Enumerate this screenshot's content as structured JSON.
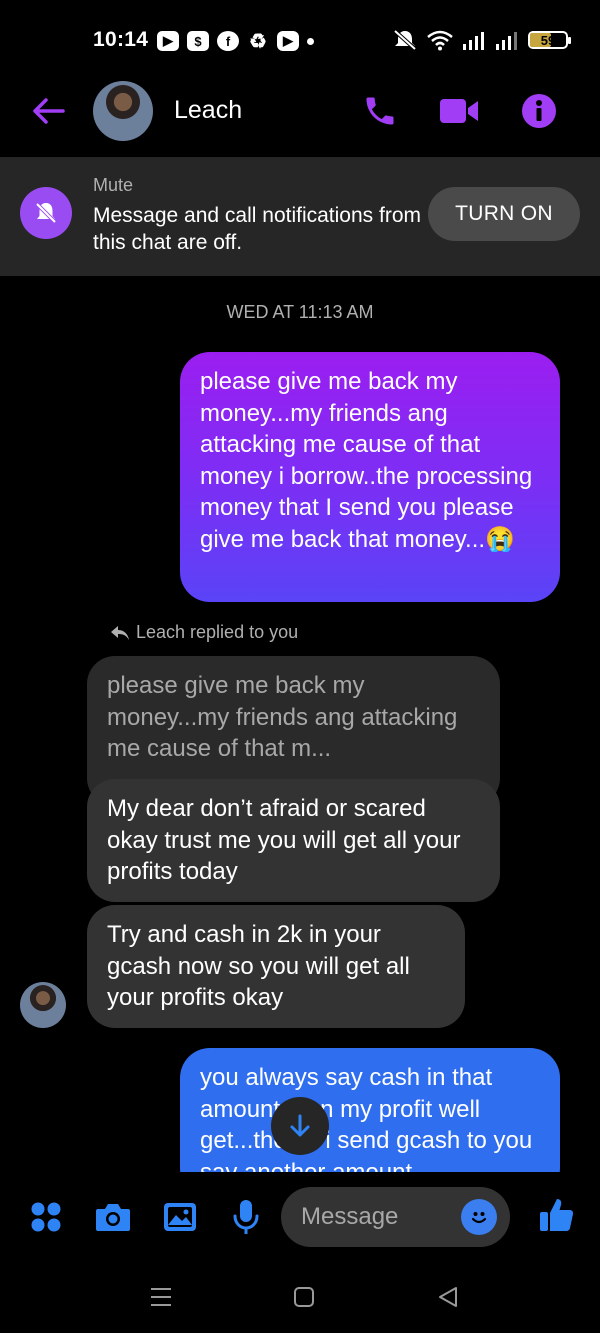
{
  "status_bar": {
    "time": "10:14",
    "battery": "59",
    "battery_level": 0.59,
    "notification_icons": [
      "youtube-icon",
      "shopping-icon",
      "facebook-icon",
      "sync-icon",
      "video-icon",
      "dot-icon"
    ],
    "right_icons": [
      "silent-icon",
      "wifi-icon",
      "signal-icon",
      "signal-icon",
      "battery-icon"
    ]
  },
  "header": {
    "contact_name": "Leach",
    "icons": [
      "back-arrow-icon",
      "phone-icon",
      "video-camera-icon",
      "info-icon"
    ],
    "accent_color": "#a23df6"
  },
  "mute_banner": {
    "title": "Mute",
    "text": "Message and call notifications from this chat are off.",
    "button": "TURN ON"
  },
  "conversation": {
    "timestamp": "WED AT 11:13 AM",
    "sent_1": "please give me back my money...my friends ang attacking me cause of that money i borrow..the processing money that I send you please give me back that money...😭",
    "reply_label": "Leach replied to you",
    "quoted": "please give me back my money...my friends ang attacking me cause of that m...",
    "received_1": "My dear don’t afraid or scared okay trust me you will get all your profits today",
    "received_2": "Try and cash in 2k in your gcash now so you will get all your profits okay",
    "sent_2": "you always say cash in that amount then my profit well get...then if i send gcash to you say another amount"
  },
  "composer": {
    "placeholder": "Message",
    "icons": [
      "menu-dots-icon",
      "camera-icon",
      "gallery-icon",
      "microphone-icon",
      "emoji-icon",
      "thumbs-up-icon"
    ]
  },
  "nav_bar": {
    "icons": [
      "recents-icon",
      "home-icon",
      "back-icon"
    ]
  }
}
